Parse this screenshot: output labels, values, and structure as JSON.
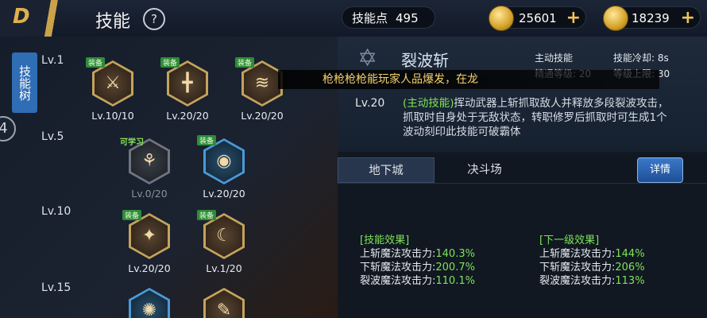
{
  "header": {
    "back_icon": "D",
    "title": "技能",
    "help": "?",
    "skill_points_label": "技能点",
    "skill_points": "495",
    "gold": "25601",
    "cash": "18239",
    "plus": "+"
  },
  "left": {
    "tree_tab": "技能树",
    "badge": "4",
    "levels": [
      "Lv.1",
      "Lv.5",
      "Lv.10",
      "Lv.15"
    ],
    "skills": [
      {
        "tag": "装备",
        "level": "Lv.10/10",
        "glyph": "⚔"
      },
      {
        "tag": "装备",
        "level": "Lv.20/20",
        "glyph": "╋"
      },
      {
        "tag": "装备",
        "level": "Lv.20/20",
        "glyph": "≋"
      },
      {
        "tag": "可学习",
        "level": "Lv.0/20",
        "glyph": "⚘"
      },
      {
        "tag": "装备",
        "level": "Lv.20/20",
        "glyph": "◉"
      },
      {
        "tag": "装备",
        "level": "Lv.20/20",
        "glyph": "✦"
      },
      {
        "tag": "装备",
        "level": "Lv.1/20",
        "glyph": "☾"
      },
      {
        "tag": "",
        "level": "",
        "glyph": "✺"
      },
      {
        "tag": "",
        "level": "",
        "glyph": "✎"
      }
    ]
  },
  "banner": "枪枪枪枪能玩家人品爆发，在龙",
  "detail": {
    "name": "裂波斩",
    "type_label": "主动技能",
    "cooldown": "技能冷却: 8s",
    "mastery": "精通等级: 20",
    "max_level": "等级上限: 30",
    "level": "Lv.20",
    "desc_tag": "(主动技能)",
    "desc": "挥动武器上斩抓取敌人并释放多段裂波攻击，抓取时自身处于无敌状态，转职修罗后抓取时可生成1个波动刻印此技能可破霸体",
    "tabs": [
      "地下城",
      "决斗场"
    ],
    "detail_button": "详情",
    "effect_title": "[技能效果]",
    "next_title": "[下一级效果]",
    "effects": [
      {
        "label": "上斩魔法攻击力:",
        "value": "140.3%",
        "next": "144%"
      },
      {
        "label": "下斩魔法攻击力:",
        "value": "200.7%",
        "next": "206%"
      },
      {
        "label": "裂波魔法攻击力:",
        "value": "110.1%",
        "next": "113%"
      }
    ]
  },
  "colors": {
    "accent": "#c9a24a",
    "green": "#7ee35a",
    "blue": "#2f6db5"
  }
}
